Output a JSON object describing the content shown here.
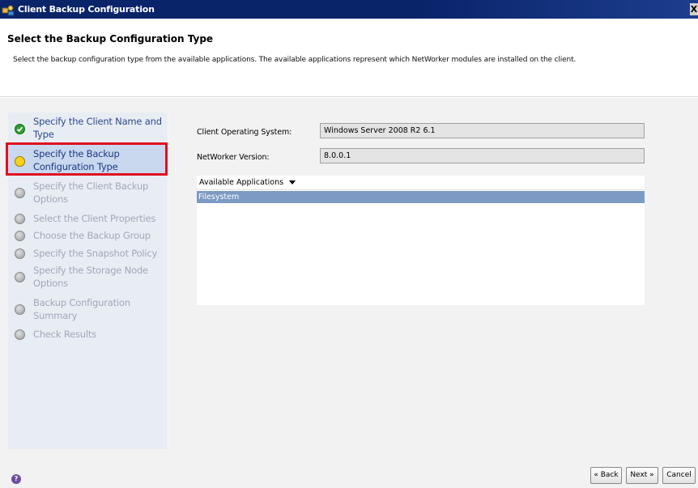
{
  "window": {
    "title": "Client Backup Configuration",
    "close_glyph": "X"
  },
  "header": {
    "title": "Select the Backup Configuration Type",
    "description": "Select the backup configuration type from the available applications.  The available applications represent which NetWorker modules are installed on the client."
  },
  "steps": [
    {
      "line1": "Specify the Client Name and",
      "line2": "Type",
      "state": "done"
    },
    {
      "line1": "Specify the Backup",
      "line2": "Configuration Type",
      "state": "current"
    },
    {
      "line1": "Specify the Client Backup",
      "line2": "Options",
      "state": "pending"
    },
    {
      "line1": "Select the Client Properties",
      "line2": "",
      "state": "pending"
    },
    {
      "line1": "Choose the Backup Group",
      "line2": "",
      "state": "pending"
    },
    {
      "line1": "Specify the Snapshot Policy",
      "line2": "",
      "state": "pending"
    },
    {
      "line1": "Specify the Storage Node",
      "line2": "Options",
      "state": "pending"
    },
    {
      "line1": "Backup Configuration",
      "line2": "Summary",
      "state": "pending"
    },
    {
      "line1": "Check Results",
      "line2": "",
      "state": "pending"
    }
  ],
  "form": {
    "os_label": "Client Operating System:",
    "os_value": "Windows Server 2008 R2 6.1",
    "version_label": "NetWorker Version:",
    "version_value": "8.0.0.1"
  },
  "apps": {
    "header": "Available Applications",
    "items": [
      "Filesystem"
    ]
  },
  "buttons": {
    "back": "« Back",
    "next": "Next »",
    "cancel": "Cancel"
  },
  "help_glyph": "?",
  "colors": {
    "titlebar": "#0a246a",
    "highlight_border": "#e01020",
    "selected_row": "#7d9ac4",
    "step_done_icon": "#2e9d2e",
    "step_current_icon": "#f7d21a"
  }
}
